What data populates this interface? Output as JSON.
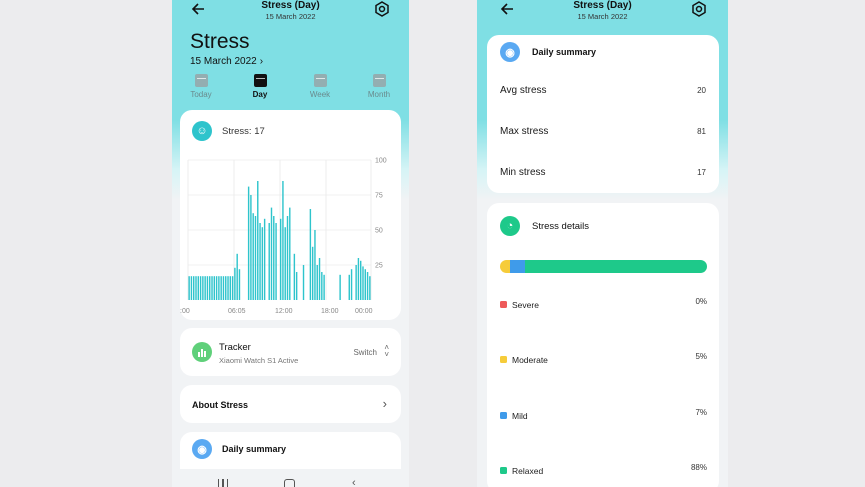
{
  "left": {
    "header": {
      "title": "Stress (Day)",
      "subtitle": "15 March 2022"
    },
    "hero": {
      "title": "Stress",
      "date": "15 March 2022",
      "chevron": "›"
    },
    "tabs": [
      {
        "label": "Today",
        "active": false
      },
      {
        "label": "Day",
        "active": true
      },
      {
        "label": "Week",
        "active": false
      },
      {
        "label": "Month",
        "active": false
      }
    ],
    "stress_card": {
      "label": "Stress: 17",
      "icon": "smile-icon"
    },
    "tracker": {
      "title": "Tracker",
      "device": "Xiaomi Watch S1 Active",
      "switch_label": "Switch"
    },
    "about": {
      "label": "About Stress"
    },
    "daily_summary_peek": {
      "label": "Daily summary"
    }
  },
  "right": {
    "header": {
      "title": "Stress (Day)",
      "subtitle": "15 March 2022"
    },
    "daily_summary": {
      "title": "Daily summary",
      "rows": [
        {
          "label": "Avg stress",
          "value": "20"
        },
        {
          "label": "Max stress",
          "value": "81"
        },
        {
          "label": "Min stress",
          "value": "17"
        }
      ]
    },
    "stress_details": {
      "title": "Stress details",
      "levels": [
        {
          "label": "Severe",
          "value": "0%",
          "color": "#ee5a5a",
          "fraction": 0.0
        },
        {
          "label": "Moderate",
          "value": "5%",
          "color": "#f6cc3a",
          "fraction": 0.05
        },
        {
          "label": "Mild",
          "value": "7%",
          "color": "#3f9bea",
          "fraction": 0.07
        },
        {
          "label": "Relaxed",
          "value": "88%",
          "color": "#1ec98a",
          "fraction": 0.88
        }
      ]
    }
  },
  "colors": {
    "accent": "#2ec4cc",
    "header_bg": "#7fdfe4",
    "tracker_green": "#5fd07a"
  },
  "chart_data": {
    "type": "bar",
    "title": "Stress: 17",
    "xlabel": "",
    "ylabel": "",
    "ylim": [
      0,
      100
    ],
    "yticks": [
      "100",
      "75",
      "50",
      "25"
    ],
    "xticks": [
      ":00",
      "06:05",
      "12:00",
      "18:00",
      "00:00"
    ],
    "values": [
      17,
      17,
      17,
      17,
      17,
      17,
      17,
      17,
      17,
      17,
      17,
      17,
      17,
      17,
      17,
      17,
      17,
      17,
      17,
      17,
      23,
      33,
      22,
      0,
      0,
      0,
      81,
      75,
      62,
      60,
      85,
      55,
      52,
      58,
      0,
      55,
      66,
      60,
      55,
      0,
      58,
      85,
      52,
      60,
      66,
      0,
      33,
      20,
      0,
      0,
      25,
      0,
      0,
      65,
      38,
      50,
      25,
      30,
      20,
      18,
      0,
      0,
      0,
      0,
      0,
      0,
      18,
      0,
      0,
      0,
      18,
      22,
      0,
      25,
      30,
      28,
      24,
      22,
      20,
      17
    ]
  }
}
